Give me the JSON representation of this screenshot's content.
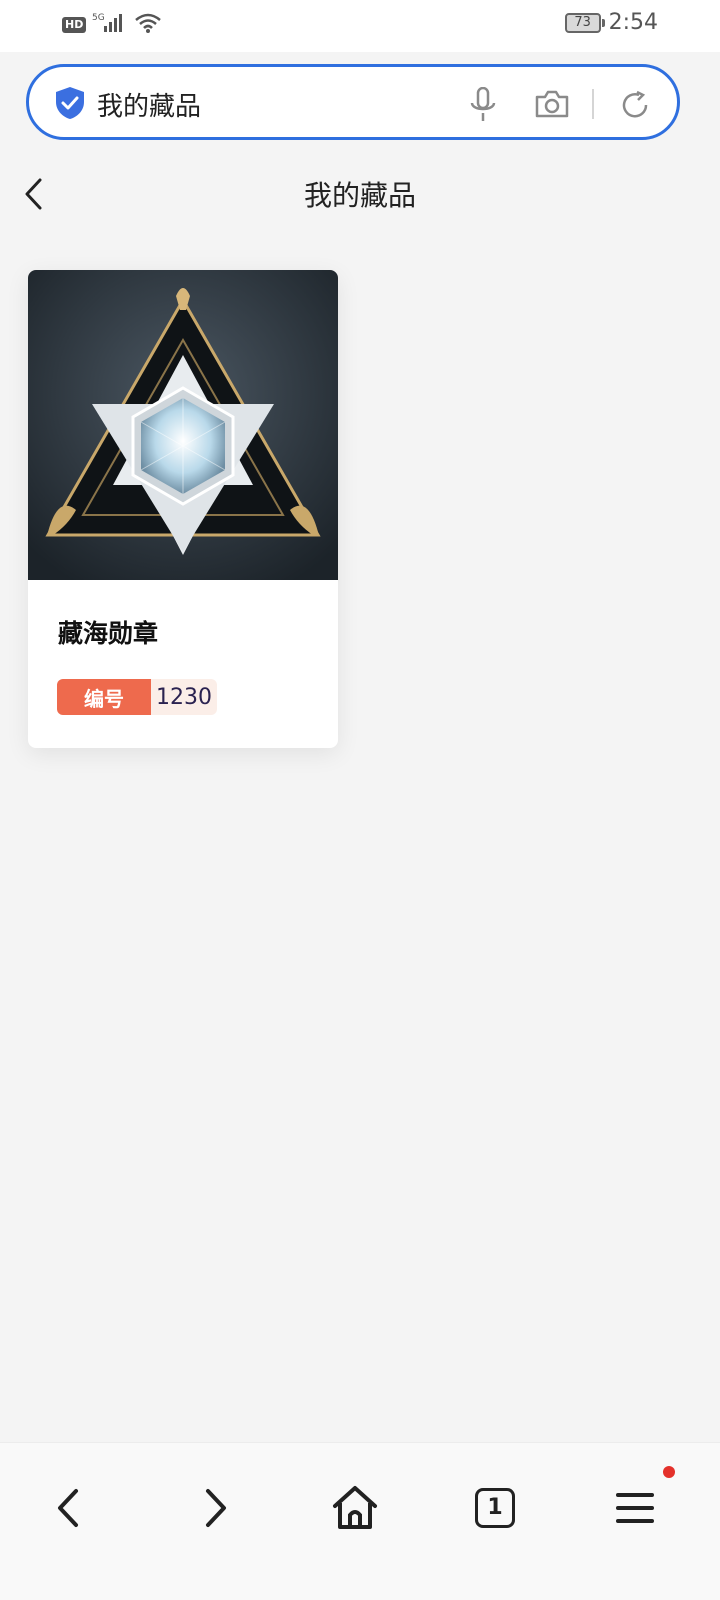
{
  "status_bar": {
    "hd": "HD",
    "network": "5G",
    "battery": "73",
    "time": "2:54",
    "icons": [
      "hd-icon",
      "signal-icon",
      "wifi-icon",
      "battery-icon"
    ]
  },
  "search": {
    "value": "我的藏品",
    "icons": [
      "shield-check-icon",
      "microphone-icon",
      "camera-icon",
      "reload-icon"
    ],
    "accent": "#2f6fdf"
  },
  "page": {
    "title": "我的藏品",
    "back_icon": "chevron-left-icon"
  },
  "collection": {
    "items": [
      {
        "name": "藏海勋章",
        "number_label": "编号",
        "number": "1230",
        "image": "crystal-triangle-medal"
      }
    ]
  },
  "bottom_nav": {
    "tab_count": "1",
    "icons": [
      "back-icon",
      "forward-icon",
      "home-icon",
      "tabs-icon",
      "menu-icon"
    ],
    "notification_color": "#e4312b"
  },
  "colors": {
    "badge_label_bg": "#ee6a4d",
    "badge_value_bg": "#fbeee8",
    "page_bg": "#f4f4f4"
  }
}
